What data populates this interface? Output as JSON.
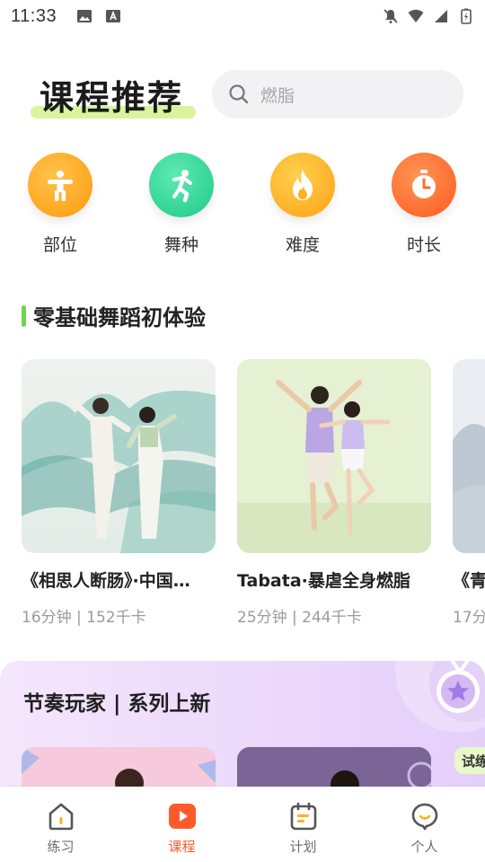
{
  "status_bar": {
    "time": "11:33"
  },
  "header": {
    "title": "课程推荐",
    "search_placeholder": "燃脂"
  },
  "categories": [
    {
      "label": "部位",
      "icon": "body-part-icon",
      "color": "#ffa51c"
    },
    {
      "label": "舞种",
      "icon": "dance-style-icon",
      "color": "#2fd69a"
    },
    {
      "label": "难度",
      "icon": "flame-icon",
      "color": "#ffae1e"
    },
    {
      "label": "时长",
      "icon": "stopwatch-icon",
      "color": "#ff6a2d"
    }
  ],
  "section": {
    "title": "零基础舞蹈初体验",
    "accent_color": "#6fd64d",
    "courses": [
      {
        "name": "《相思人断肠》·中国…",
        "meta": "16分钟 | 152千卡"
      },
      {
        "name": "Tabata·暴虐全身燃脂",
        "meta": "25分钟 | 244千卡"
      },
      {
        "name": "《青",
        "meta": "17分"
      }
    ]
  },
  "promo": {
    "title": "节奏玩家 | 系列上新",
    "trial_tag": "试练"
  },
  "bottom_nav": {
    "active_color": "#ff5a2c",
    "items": [
      {
        "label": "练习",
        "icon": "house-icon"
      },
      {
        "label": "课程",
        "icon": "play-icon"
      },
      {
        "label": "计划",
        "icon": "calendar-icon"
      },
      {
        "label": "个人",
        "icon": "profile-icon"
      }
    ]
  }
}
